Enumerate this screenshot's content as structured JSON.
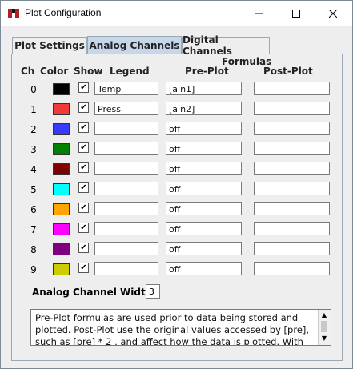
{
  "window": {
    "title": "Plot Configuration",
    "min_icon": "minimize-icon",
    "max_icon": "maximize-icon",
    "close_icon": "close-icon"
  },
  "tabs": [
    {
      "label": "Plot Settings",
      "active": false
    },
    {
      "label": "Analog Channels",
      "active": true
    },
    {
      "label": "Digital Channels",
      "active": false
    }
  ],
  "headers": {
    "ch": "Ch",
    "color": "Color",
    "show": "Show",
    "legend": "Legend",
    "formulas": "Formulas",
    "pre_plot": "Pre-Plot",
    "post_plot": "Post-Plot"
  },
  "channels": [
    {
      "ch": "0",
      "color": "#000000",
      "show": true,
      "legend": "Temp",
      "pre": "[ain1]",
      "post": ""
    },
    {
      "ch": "1",
      "color": "#f03a3a",
      "show": true,
      "legend": "Press",
      "pre": "[ain2]",
      "post": ""
    },
    {
      "ch": "2",
      "color": "#3a3aff",
      "show": true,
      "legend": "",
      "pre": "off",
      "post": ""
    },
    {
      "ch": "3",
      "color": "#008000",
      "show": true,
      "legend": "",
      "pre": "off",
      "post": ""
    },
    {
      "ch": "4",
      "color": "#800000",
      "show": true,
      "legend": "",
      "pre": "off",
      "post": ""
    },
    {
      "ch": "5",
      "color": "#00ffff",
      "show": true,
      "legend": "",
      "pre": "off",
      "post": ""
    },
    {
      "ch": "6",
      "color": "#ffa500",
      "show": true,
      "legend": "",
      "pre": "off",
      "post": ""
    },
    {
      "ch": "7",
      "color": "#ff00ff",
      "show": true,
      "legend": "",
      "pre": "off",
      "post": ""
    },
    {
      "ch": "8",
      "color": "#800080",
      "show": true,
      "legend": "",
      "pre": "off",
      "post": ""
    },
    {
      "ch": "9",
      "color": "#cccc00",
      "show": true,
      "legend": "",
      "pre": "off",
      "post": ""
    }
  ],
  "width": {
    "label": "Analog Channel Width:",
    "value": "3"
  },
  "description": "Pre-Plot formulas are used prior to data being stored and plotted. Post-Plot use the original values accessed by [pre], such as [pre] * 2 , and affect how the data is plotted. With"
}
